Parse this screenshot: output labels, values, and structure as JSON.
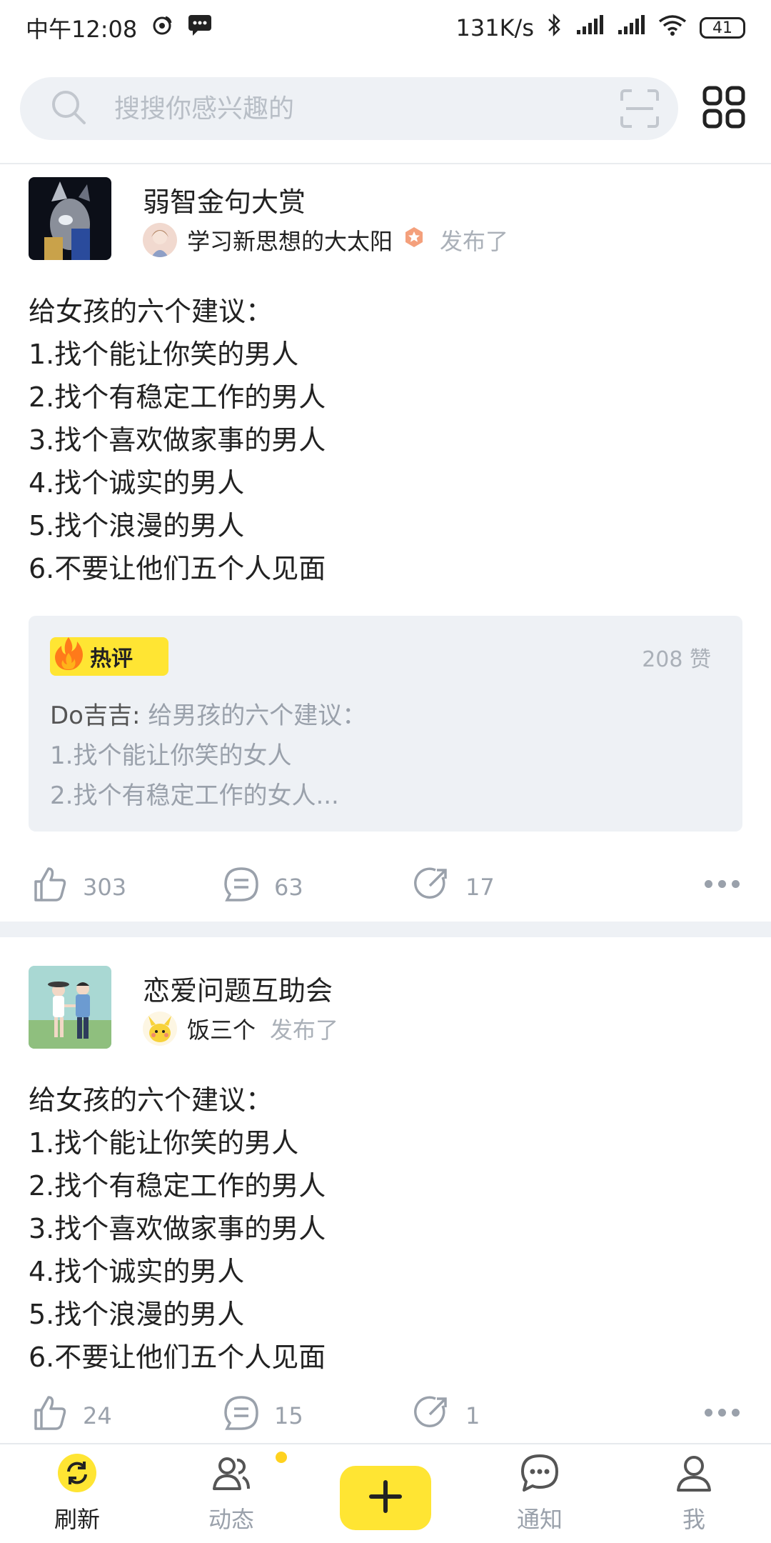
{
  "status_bar": {
    "time": "中午12:08",
    "net_speed": "131K/s",
    "battery": "41"
  },
  "search": {
    "placeholder": "搜搜你感兴趣的"
  },
  "posts": [
    {
      "group_name": "弱智金句大赏",
      "author": "学习新思想的大太阳",
      "published": "发布了",
      "body": "给女孩的六个建议：\n1.找个能让你笑的男人\n2.找个有稳定工作的男人\n3.找个喜欢做家事的男人\n4.找个诚实的男人\n5.找个浪漫的男人\n6.不要让他们五个人见面",
      "hot_comment": {
        "badge": "热评",
        "likes": "208 赞",
        "author": "Do吉吉:",
        "text": " 给男孩的六个建议：\n1.找个能让你笑的女人\n2.找个有稳定工作的女人..."
      },
      "likes": "303",
      "comments": "63",
      "shares": "17"
    },
    {
      "group_name": "恋爱问题互助会",
      "author": "饭三个",
      "published": "发布了",
      "body": "给女孩的六个建议：\n1.找个能让你笑的男人\n2.找个有稳定工作的男人\n3.找个喜欢做家事的男人\n4.找个诚实的男人\n5.找个浪漫的男人\n6.不要让他们五个人见面",
      "likes": "24",
      "comments": "15",
      "shares": "1"
    }
  ],
  "tab_bar": {
    "refresh": "刷新",
    "activity": "动态",
    "notify": "通知",
    "me": "我"
  },
  "colors": {
    "accent": "#ffe533",
    "muted": "#9aa1ab",
    "background_gray": "#eef1f5"
  }
}
